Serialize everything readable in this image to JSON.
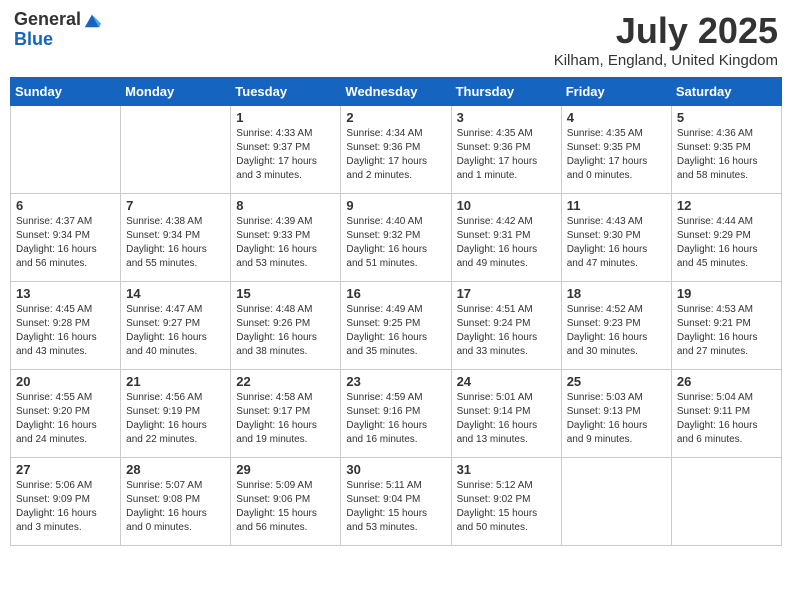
{
  "logo": {
    "general": "General",
    "blue": "Blue"
  },
  "title": "July 2025",
  "location": "Kilham, England, United Kingdom",
  "days_of_week": [
    "Sunday",
    "Monday",
    "Tuesday",
    "Wednesday",
    "Thursday",
    "Friday",
    "Saturday"
  ],
  "weeks": [
    [
      {
        "day": "",
        "info": ""
      },
      {
        "day": "",
        "info": ""
      },
      {
        "day": "1",
        "info": "Sunrise: 4:33 AM\nSunset: 9:37 PM\nDaylight: 17 hours\nand 3 minutes."
      },
      {
        "day": "2",
        "info": "Sunrise: 4:34 AM\nSunset: 9:36 PM\nDaylight: 17 hours\nand 2 minutes."
      },
      {
        "day": "3",
        "info": "Sunrise: 4:35 AM\nSunset: 9:36 PM\nDaylight: 17 hours\nand 1 minute."
      },
      {
        "day": "4",
        "info": "Sunrise: 4:35 AM\nSunset: 9:35 PM\nDaylight: 17 hours\nand 0 minutes."
      },
      {
        "day": "5",
        "info": "Sunrise: 4:36 AM\nSunset: 9:35 PM\nDaylight: 16 hours\nand 58 minutes."
      }
    ],
    [
      {
        "day": "6",
        "info": "Sunrise: 4:37 AM\nSunset: 9:34 PM\nDaylight: 16 hours\nand 56 minutes."
      },
      {
        "day": "7",
        "info": "Sunrise: 4:38 AM\nSunset: 9:34 PM\nDaylight: 16 hours\nand 55 minutes."
      },
      {
        "day": "8",
        "info": "Sunrise: 4:39 AM\nSunset: 9:33 PM\nDaylight: 16 hours\nand 53 minutes."
      },
      {
        "day": "9",
        "info": "Sunrise: 4:40 AM\nSunset: 9:32 PM\nDaylight: 16 hours\nand 51 minutes."
      },
      {
        "day": "10",
        "info": "Sunrise: 4:42 AM\nSunset: 9:31 PM\nDaylight: 16 hours\nand 49 minutes."
      },
      {
        "day": "11",
        "info": "Sunrise: 4:43 AM\nSunset: 9:30 PM\nDaylight: 16 hours\nand 47 minutes."
      },
      {
        "day": "12",
        "info": "Sunrise: 4:44 AM\nSunset: 9:29 PM\nDaylight: 16 hours\nand 45 minutes."
      }
    ],
    [
      {
        "day": "13",
        "info": "Sunrise: 4:45 AM\nSunset: 9:28 PM\nDaylight: 16 hours\nand 43 minutes."
      },
      {
        "day": "14",
        "info": "Sunrise: 4:47 AM\nSunset: 9:27 PM\nDaylight: 16 hours\nand 40 minutes."
      },
      {
        "day": "15",
        "info": "Sunrise: 4:48 AM\nSunset: 9:26 PM\nDaylight: 16 hours\nand 38 minutes."
      },
      {
        "day": "16",
        "info": "Sunrise: 4:49 AM\nSunset: 9:25 PM\nDaylight: 16 hours\nand 35 minutes."
      },
      {
        "day": "17",
        "info": "Sunrise: 4:51 AM\nSunset: 9:24 PM\nDaylight: 16 hours\nand 33 minutes."
      },
      {
        "day": "18",
        "info": "Sunrise: 4:52 AM\nSunset: 9:23 PM\nDaylight: 16 hours\nand 30 minutes."
      },
      {
        "day": "19",
        "info": "Sunrise: 4:53 AM\nSunset: 9:21 PM\nDaylight: 16 hours\nand 27 minutes."
      }
    ],
    [
      {
        "day": "20",
        "info": "Sunrise: 4:55 AM\nSunset: 9:20 PM\nDaylight: 16 hours\nand 24 minutes."
      },
      {
        "day": "21",
        "info": "Sunrise: 4:56 AM\nSunset: 9:19 PM\nDaylight: 16 hours\nand 22 minutes."
      },
      {
        "day": "22",
        "info": "Sunrise: 4:58 AM\nSunset: 9:17 PM\nDaylight: 16 hours\nand 19 minutes."
      },
      {
        "day": "23",
        "info": "Sunrise: 4:59 AM\nSunset: 9:16 PM\nDaylight: 16 hours\nand 16 minutes."
      },
      {
        "day": "24",
        "info": "Sunrise: 5:01 AM\nSunset: 9:14 PM\nDaylight: 16 hours\nand 13 minutes."
      },
      {
        "day": "25",
        "info": "Sunrise: 5:03 AM\nSunset: 9:13 PM\nDaylight: 16 hours\nand 9 minutes."
      },
      {
        "day": "26",
        "info": "Sunrise: 5:04 AM\nSunset: 9:11 PM\nDaylight: 16 hours\nand 6 minutes."
      }
    ],
    [
      {
        "day": "27",
        "info": "Sunrise: 5:06 AM\nSunset: 9:09 PM\nDaylight: 16 hours\nand 3 minutes."
      },
      {
        "day": "28",
        "info": "Sunrise: 5:07 AM\nSunset: 9:08 PM\nDaylight: 16 hours\nand 0 minutes."
      },
      {
        "day": "29",
        "info": "Sunrise: 5:09 AM\nSunset: 9:06 PM\nDaylight: 15 hours\nand 56 minutes."
      },
      {
        "day": "30",
        "info": "Sunrise: 5:11 AM\nSunset: 9:04 PM\nDaylight: 15 hours\nand 53 minutes."
      },
      {
        "day": "31",
        "info": "Sunrise: 5:12 AM\nSunset: 9:02 PM\nDaylight: 15 hours\nand 50 minutes."
      },
      {
        "day": "",
        "info": ""
      },
      {
        "day": "",
        "info": ""
      }
    ]
  ]
}
